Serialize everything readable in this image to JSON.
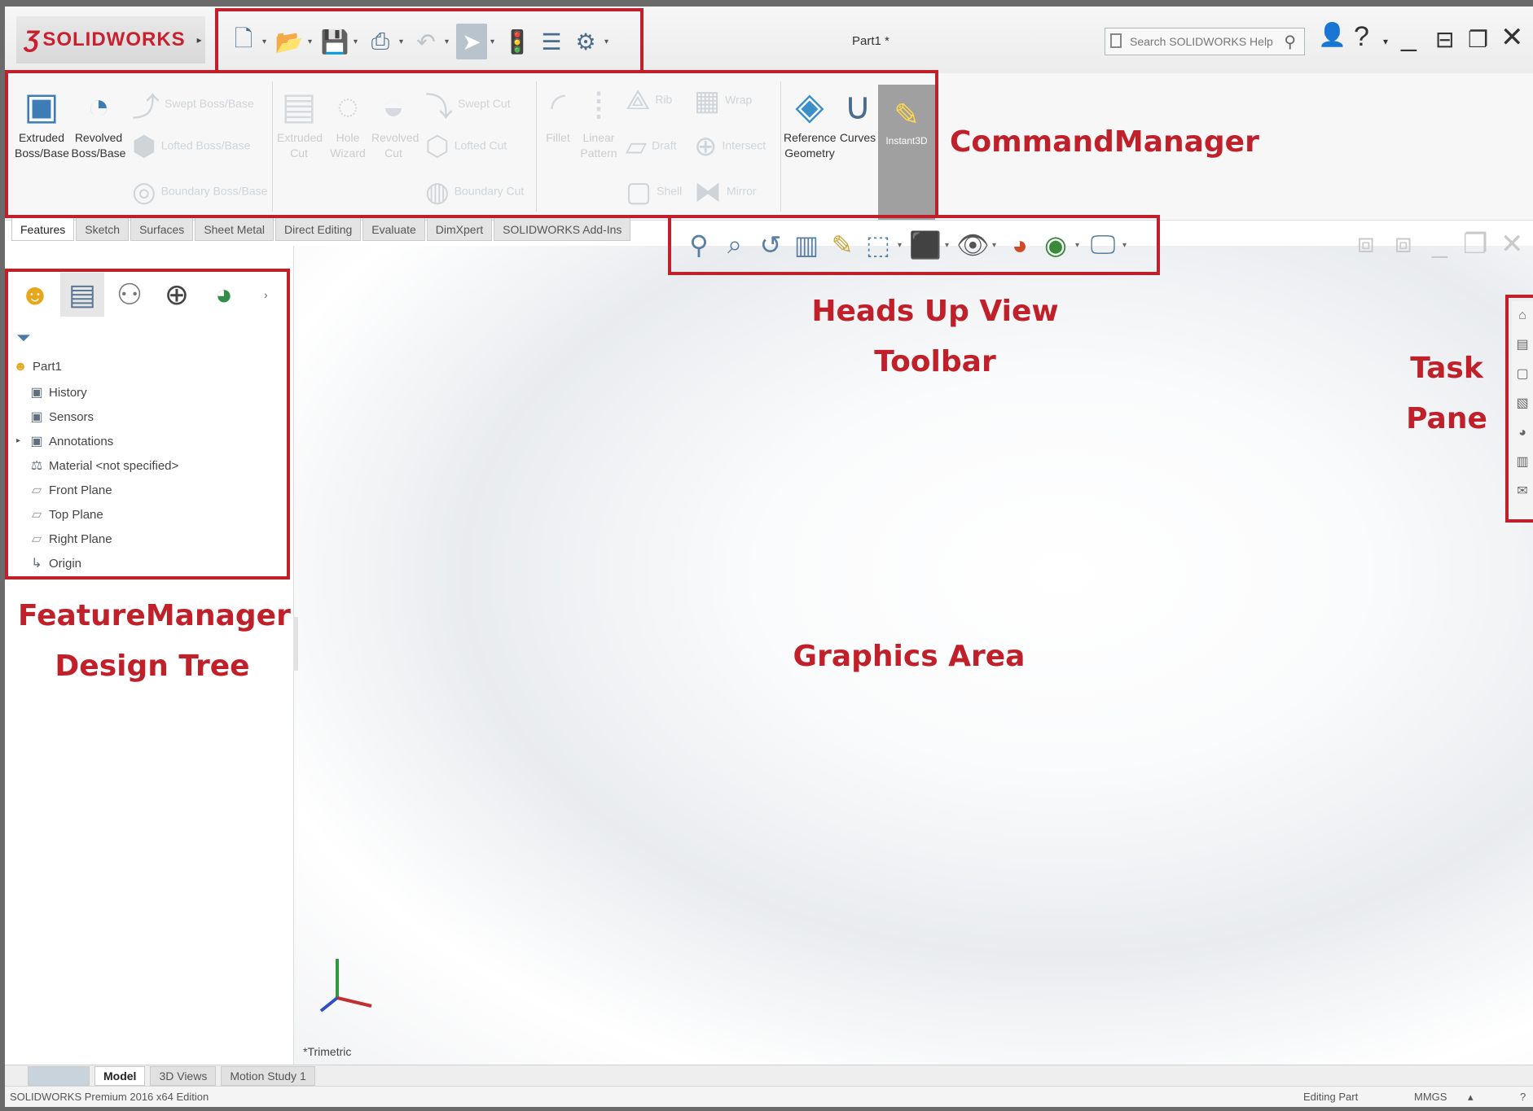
{
  "app": {
    "logo_text": "SOLIDWORKS",
    "document_title": "Part1 *",
    "search_placeholder": "Search SOLIDWORKS Help"
  },
  "quick_access": {
    "icons": [
      "new-document-icon",
      "open-icon",
      "save-icon",
      "print-icon",
      "undo-icon",
      "select-icon",
      "rebuild-icon",
      "file-properties-icon",
      "options-icon"
    ]
  },
  "command_manager": {
    "extruded_boss": "Extruded Boss/Base",
    "revolved_boss": "Revolved Boss/Base",
    "swept_boss": "Swept Boss/Base",
    "lofted_boss": "Lofted Boss/Base",
    "boundary_boss": "Boundary Boss/Base",
    "extruded_cut": "Extruded Cut",
    "hole_wizard": "Hole Wizard",
    "revolved_cut": "Revolved Cut",
    "swept_cut": "Swept Cut",
    "lofted_cut": "Lofted Cut",
    "boundary_cut": "Boundary Cut",
    "fillet": "Fillet",
    "linear_pattern": "Linear Pattern",
    "rib": "Rib",
    "wrap": "Wrap",
    "draft": "Draft",
    "intersect": "Intersect",
    "shell": "Shell",
    "mirror": "Mirror",
    "reference_geometry": "Reference Geometry",
    "curves": "Curves",
    "instant3d": "Instant3D"
  },
  "tabs": [
    "Features",
    "Sketch",
    "Surfaces",
    "Sheet Metal",
    "Direct Editing",
    "Evaluate",
    "DimXpert",
    "SOLIDWORKS Add-Ins"
  ],
  "feature_tree": {
    "root": "Part1",
    "items": [
      "History",
      "Sensors",
      "Annotations",
      "Material <not specified>",
      "Front Plane",
      "Top Plane",
      "Right Plane",
      "Origin"
    ]
  },
  "annotations": {
    "command_manager": "CommandManager",
    "heads_up": "Heads Up View Toolbar",
    "task_pane_line1": "Task",
    "task_pane_line2": "Pane",
    "feature_manager_line1": "FeatureManager",
    "feature_manager_line2": "Design Tree",
    "graphics_area": "Graphics Area"
  },
  "graphics": {
    "view_label": "*Trimetric"
  },
  "bottom_tabs": [
    "Model",
    "3D Views",
    "Motion Study 1"
  ],
  "status": {
    "left": "SOLIDWORKS Premium 2016 x64 Edition",
    "editing": "Editing Part",
    "units": "MMGS"
  },
  "colors": {
    "annotation_red": "#c0202a",
    "brand_red": "#c8202e"
  }
}
